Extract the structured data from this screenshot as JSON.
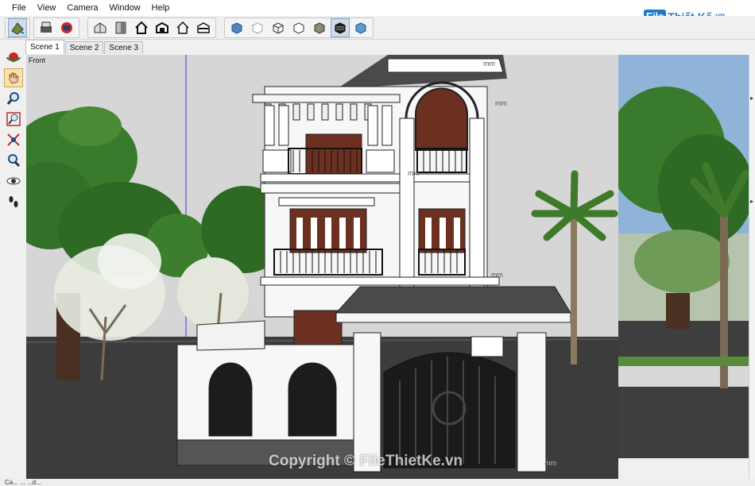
{
  "menu": [
    "File",
    "View",
    "Camera",
    "Window",
    "Help"
  ],
  "toolbar": {
    "groups": [
      [
        "paint-bucket-icon"
      ],
      [
        "print-icon",
        "model-info-icon"
      ],
      [
        "iso-view-icon",
        "top-view-icon",
        "front-view-icon",
        "right-view-icon",
        "back-view-icon",
        "left-view-icon"
      ],
      [
        "xray-style-icon",
        "back-edges-style-icon",
        "wireframe-style-icon",
        "hidden-line-style-icon",
        "shaded-style-icon",
        "textured-style-icon",
        "monochrome-style-icon"
      ]
    ],
    "active_style": "textured-style-icon"
  },
  "scenes": [
    "Scene 1",
    "Scene 2",
    "Scene 3"
  ],
  "active_scene": "Scene 1",
  "left_tools": [
    "orbit-icon",
    "pan-icon",
    "zoom-icon",
    "zoom-window-icon",
    "zoom-extents-icon",
    "previous-view-icon",
    "look-around-icon",
    "walk-icon"
  ],
  "active_left_tool": "pan-icon",
  "viewport": {
    "view_label": "Front",
    "dimension_text": "mm"
  },
  "watermark": {
    "logo_badge": "File",
    "logo_text": "Thiết Kế",
    "logo_suffix": ".vn",
    "copyright": "Copyright © FileThietKe.vn"
  },
  "status": {
    "text": "Ca... ... ...d..."
  },
  "colors": {
    "sky": "#8fb4d8",
    "ground": "#3c3c3c",
    "wall": "#f5f5f5",
    "roof": "#4a4a4a",
    "wood": "#6b3020",
    "tree": "#3f7a2a",
    "accent": "#1a78c8"
  }
}
